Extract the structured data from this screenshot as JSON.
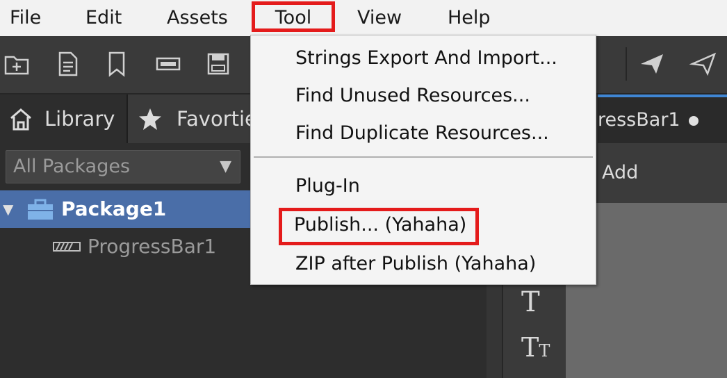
{
  "menubar": {
    "items": [
      "File",
      "Edit",
      "Assets",
      "Tool",
      "View",
      "Help"
    ]
  },
  "toolbar": {
    "icons": [
      "new-folder-icon",
      "new-document-icon",
      "bookmark-icon",
      "new-component-icon",
      "save-icon",
      "package-icon",
      "publish-icon",
      "publish-all-icon"
    ]
  },
  "left_panel": {
    "tabs": [
      "Library",
      "Favorties"
    ],
    "package_filter": "All Packages",
    "tree": {
      "package": "Package1",
      "child": "ProgressBar1"
    }
  },
  "right_panel": {
    "doc_tab": "ressBar1",
    "add_label": "Add"
  },
  "tool_menu": {
    "items": [
      "Strings Export And Import...",
      "Find Unused Resources...",
      "Find Duplicate Resources...",
      "Plug-In",
      "Publish... (Yahaha)",
      "ZIP after Publish (Yahaha)"
    ]
  },
  "colors": {
    "highlight_box": "#e41b1b",
    "selection": "#4a6ea8",
    "tab_accent": "#3f86d4"
  }
}
